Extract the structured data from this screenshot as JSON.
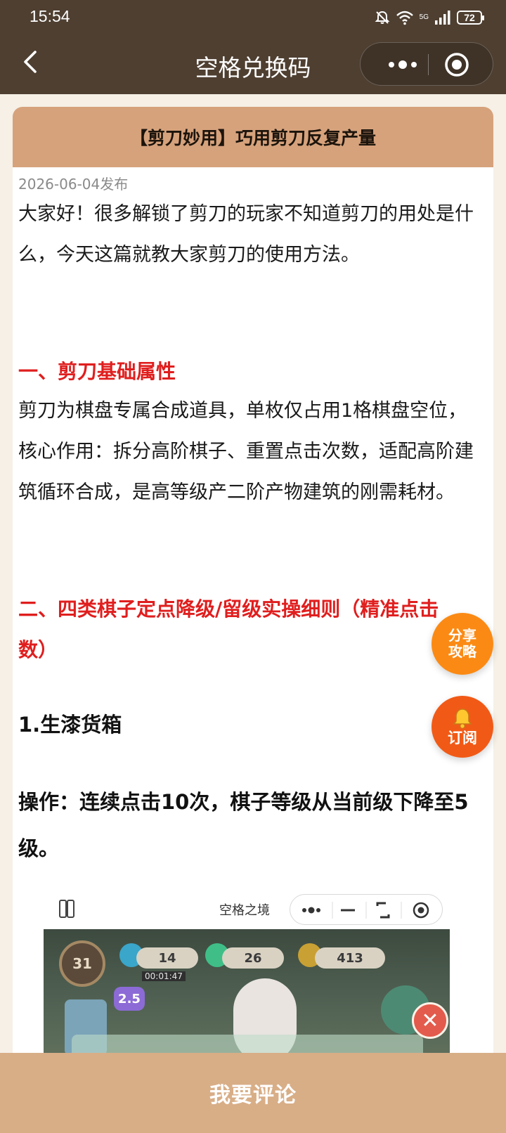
{
  "status_bar": {
    "time": "15:54",
    "network": "5G",
    "battery": "72"
  },
  "nav": {
    "title": "空格兑换码"
  },
  "article": {
    "title": "【剪刀妙用】巧用剪刀反复产量",
    "date": "2026-06-04发布",
    "intro": "大家好！很多解锁了剪刀的玩家不知道剪刀的用处是什么，今天这篇就教大家剪刀的使用方法。",
    "section1_heading": "一、剪刀基础属性",
    "section1_text": "剪刀为棋盘专属合成道具，单枚仅占用1格棋盘空位，核心作用：拆分高阶棋子、重置点击次数，适配高阶建筑循环合成，是高等级产二阶产物建筑的刚需耗材。",
    "section2_heading": "二、四类棋子定点降级/留级实操细则（精准点击数）",
    "item1_heading": "1.生漆货箱",
    "item1_operation": "操作：连续点击10次，棋子等级从当前级下降至5级。"
  },
  "embedded_screenshot": {
    "title": "空格之境",
    "level": "31",
    "resource_values": [
      "14",
      "26",
      "413"
    ],
    "timer": "00:01:47",
    "badge": "2.5"
  },
  "floating": {
    "share_label": "分享攻略",
    "subscribe_label": "订阅"
  },
  "footer": {
    "comment_label": "我要评论"
  },
  "colors": {
    "header_bg": "#4e3f31",
    "card_header": "#d6a27c",
    "accent_red": "#e01e1e",
    "footer_bg": "#d8ae87"
  }
}
